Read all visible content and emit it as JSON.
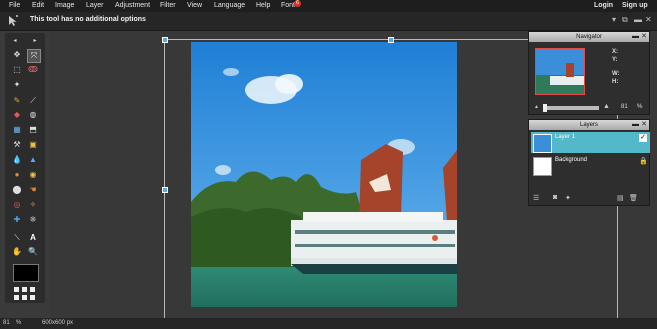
{
  "menubar": {
    "items": [
      "File",
      "Edit",
      "Image",
      "Layer",
      "Adjustment",
      "Filter",
      "View",
      "Language",
      "Help",
      "Font"
    ],
    "font_badge": "6",
    "login": "Login",
    "signup": "Sign up"
  },
  "options_bar": {
    "message": "This tool has no additional options"
  },
  "navigator": {
    "title": "Navigator",
    "x_label": "X:",
    "y_label": "Y:",
    "w_label": "W:",
    "h_label": "H:",
    "zoom_value": "81",
    "zoom_unit": "%"
  },
  "layers": {
    "title": "Layers",
    "items": [
      {
        "name": "Layer 1",
        "selected": true,
        "visible_checked": true
      },
      {
        "name": "Background",
        "selected": false,
        "locked": true
      }
    ]
  },
  "status": {
    "zoom": "81",
    "zoom_unit": "%",
    "size": "600x600 px"
  },
  "colors": {
    "accent": "#53b8c9",
    "menubar": "#1e1e1e",
    "panel": "#2e2e2e",
    "badge": "#d93025"
  },
  "icons": [
    "move-icon",
    "marquee-icon",
    "lasso-icon",
    "crop-icon",
    "wand-icon",
    "brush-icon",
    "pencil-icon",
    "eraser-icon",
    "bucket-icon",
    "gradient-icon",
    "clone-icon",
    "blur-icon",
    "sharpen-icon",
    "dodge-icon",
    "burn-icon",
    "sponge-icon",
    "smudge-icon",
    "redeye-icon",
    "spot-icon",
    "color-picker-icon",
    "text-icon",
    "hand-icon",
    "zoom-icon"
  ]
}
